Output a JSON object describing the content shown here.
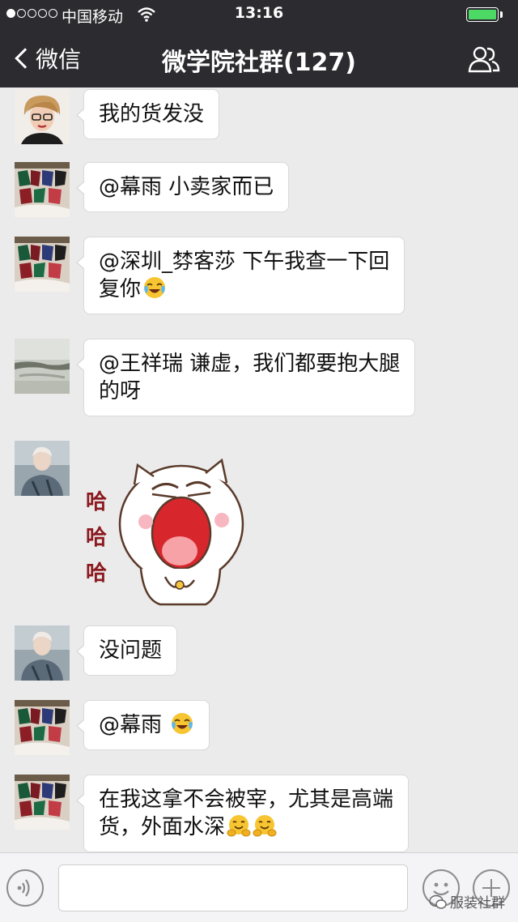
{
  "status_bar": {
    "signal_dots_filled": 1,
    "signal_dots_total": 5,
    "carrier": "中国移动",
    "time": "13:16",
    "battery_color": "#4cd964"
  },
  "nav": {
    "back_label": "微信",
    "title": "微学院社群(127)",
    "members_icon": "group-icon"
  },
  "messages": [
    {
      "avatar": "avatar-woman-glasses",
      "lines": [
        "我的货发没"
      ],
      "emojis": []
    },
    {
      "avatar": "avatar-clothing-rack",
      "lines": [
        "@幕雨 小卖家而已"
      ],
      "emojis": []
    },
    {
      "avatar": "avatar-clothing-rack",
      "lines": [
        "@深圳_棼客莎 下午我查一下回",
        "复你"
      ],
      "emojis": [
        "crying-laugh-emoji"
      ]
    },
    {
      "avatar": "avatar-landscape",
      "lines": [
        "@王祥瑞 谦虚，我们都要抱大腿",
        "的呀"
      ],
      "emojis": []
    },
    {
      "avatar": "avatar-woman-portrait",
      "sticker": {
        "text": [
          "哈",
          "哈",
          "哈"
        ],
        "kind": "laughing-cat-sticker"
      }
    },
    {
      "avatar": "avatar-woman-portrait",
      "lines": [
        "没问题"
      ],
      "emojis": []
    },
    {
      "avatar": "avatar-clothing-rack",
      "lines": [
        "@幕雨"
      ],
      "emojis": [
        "crying-laugh-emoji"
      ]
    },
    {
      "avatar": "avatar-clothing-rack",
      "lines": [
        "在我这拿不会被宰，尤其是高端",
        "货，外面水深"
      ],
      "emojis": [
        "hug-emoji",
        "hug-emoji"
      ]
    }
  ],
  "input_bar": {
    "voice_icon": "voice-icon",
    "emoji_icon": "smiley-icon",
    "plus_icon": "plus-icon"
  },
  "watermark": "服装社群"
}
